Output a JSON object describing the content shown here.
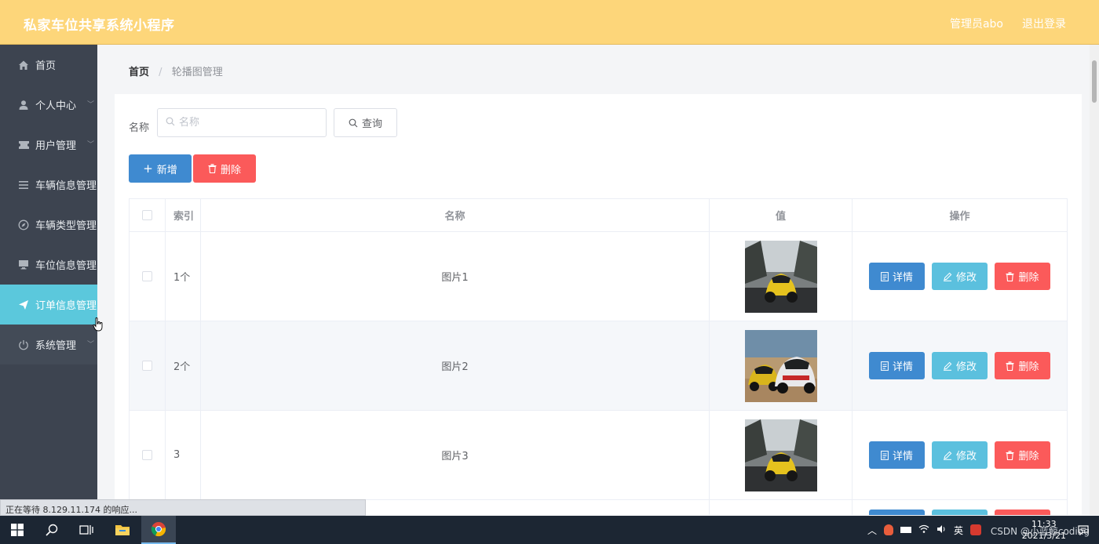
{
  "header": {
    "title": "私家车位共享系统小程序",
    "admin": "管理员abo",
    "logout": "退出登录"
  },
  "sidebar": {
    "items": [
      {
        "label": "首页",
        "icon": "home-icon",
        "chevron": false
      },
      {
        "label": "个人中心",
        "icon": "user-icon",
        "chevron": true
      },
      {
        "label": "用户管理",
        "icon": "ticket-icon",
        "chevron": true
      },
      {
        "label": "车辆信息管理",
        "icon": "list-icon",
        "chevron": false
      },
      {
        "label": "车辆类型管理",
        "icon": "compass-icon",
        "chevron": false
      },
      {
        "label": "车位信息管理",
        "icon": "monitor-icon",
        "chevron": false
      },
      {
        "label": "订单信息管理",
        "icon": "send-icon",
        "chevron": false,
        "active": true
      },
      {
        "label": "系统管理",
        "icon": "power-icon",
        "chevron": true
      }
    ]
  },
  "breadcrumb": {
    "home": "首页",
    "separator": "/",
    "current": "轮播图管理"
  },
  "search": {
    "label": "名称",
    "placeholder": "名称",
    "query_button": "查询"
  },
  "actions": {
    "add": "新增",
    "delete": "删除"
  },
  "table": {
    "headers": {
      "index": "索引",
      "name": "名称",
      "value": "值",
      "ops": "操作"
    },
    "rows": [
      {
        "index": "1个",
        "name": "图片1",
        "image": "yellow-race-car"
      },
      {
        "index": "2个",
        "name": "图片2",
        "image": "two-race-cars"
      },
      {
        "index": "3",
        "name": "图片3",
        "image": "yellow-race-car"
      }
    ],
    "row_buttons": {
      "detail": "详情",
      "edit": "修改",
      "delete": "删除"
    }
  },
  "statusbar": {
    "text": "正在等待 8.129.11.174 的响应..."
  },
  "taskbar": {
    "ime": "英",
    "time": "11:33",
    "date": "2021/3/21",
    "watermark": "CSDN @小蓝鲸coding"
  },
  "colors": {
    "header_bg": "#fdd67a",
    "sidebar_bg": "#3d4450",
    "active_item": "#5bc8dc",
    "primary": "#3f8ad0",
    "info": "#5bc0de",
    "danger": "#fb5a5a"
  }
}
